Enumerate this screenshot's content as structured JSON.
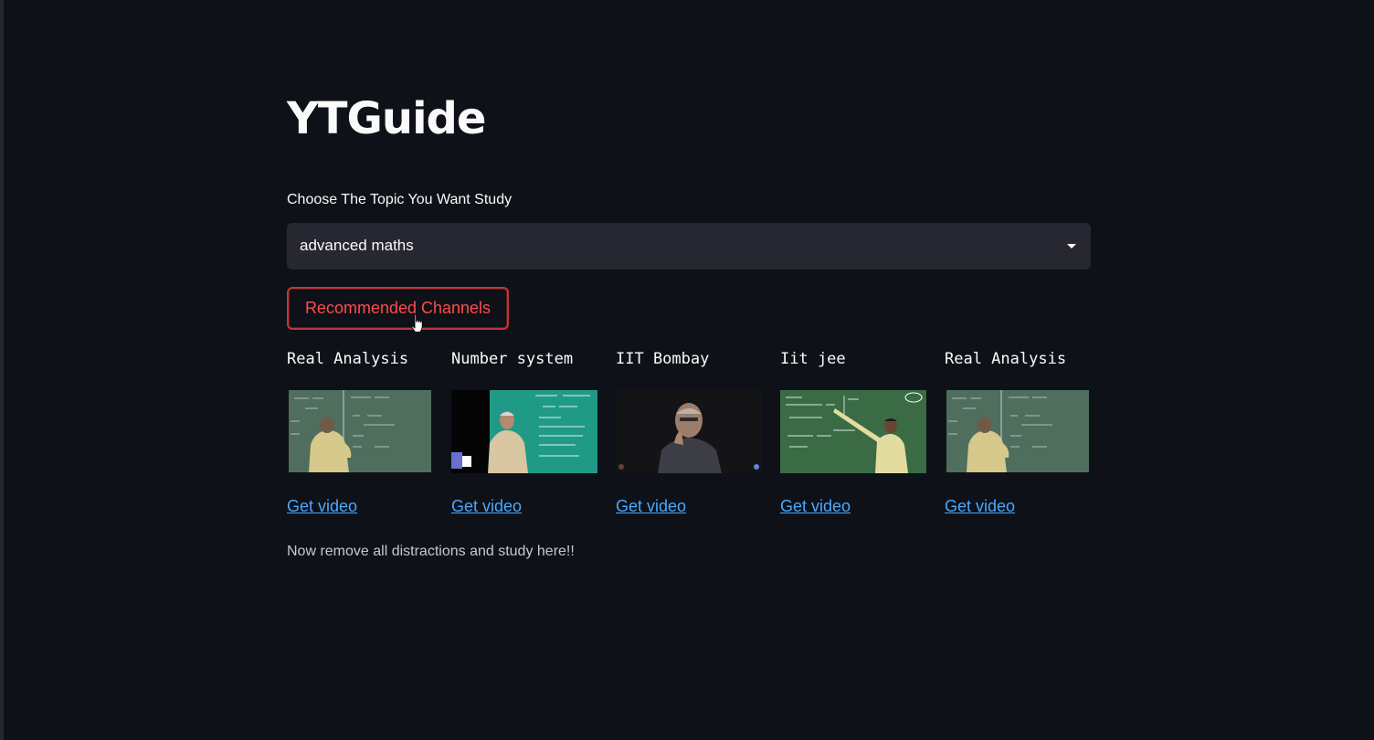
{
  "app": {
    "title": "YTGuide",
    "select": {
      "label": "Choose The Topic You Want Study",
      "value": "advanced maths"
    },
    "recommend_button_label": "Recommended Channels",
    "videos": [
      {
        "title": "Real Analysis",
        "link_label": "Get video"
      },
      {
        "title": "Number system",
        "link_label": "Get video"
      },
      {
        "title": "IIT Bombay",
        "link_label": "Get video"
      },
      {
        "title": "Iit jee",
        "link_label": "Get video"
      },
      {
        "title": "Real Analysis",
        "link_label": "Get video"
      }
    ],
    "footer_text": "Now remove all distractions and study here!!"
  },
  "colors": {
    "background": "#0e1117",
    "select_background": "#262730",
    "button_accent": "#ff4b4b",
    "link": "#4aa8ff"
  }
}
